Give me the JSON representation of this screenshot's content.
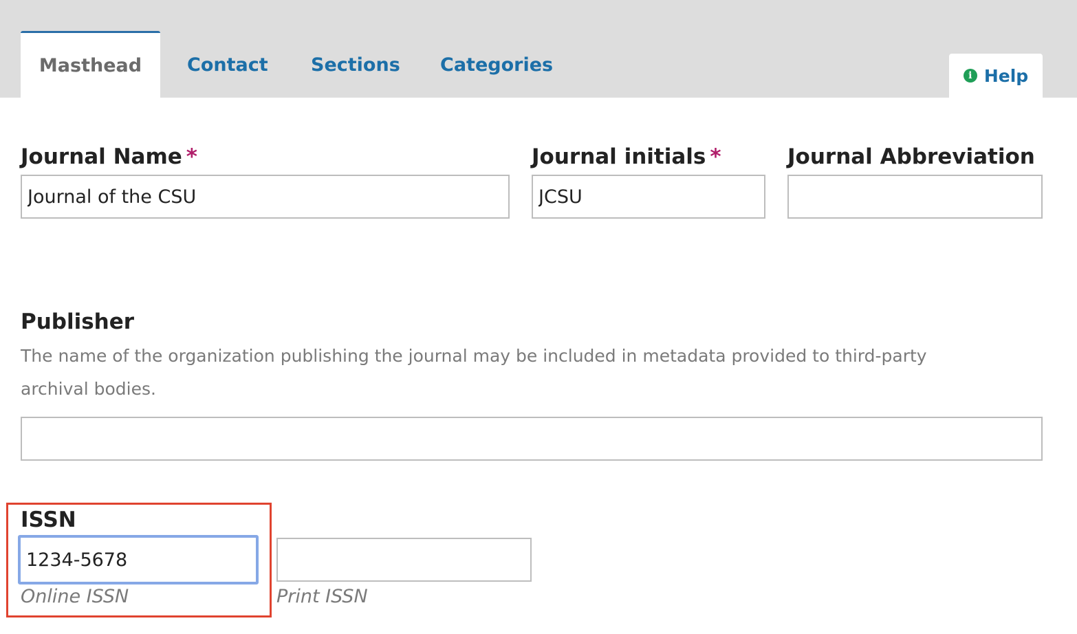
{
  "tabs": [
    {
      "label": "Masthead",
      "active": true
    },
    {
      "label": "Contact",
      "active": false
    },
    {
      "label": "Sections",
      "active": false
    },
    {
      "label": "Categories",
      "active": false
    }
  ],
  "help": {
    "label": "Help",
    "icon": "info-circle-icon"
  },
  "fields": {
    "journal_name": {
      "label": "Journal Name",
      "required": "*",
      "value": "Journal of the CSU"
    },
    "journal_initials": {
      "label": "Journal initials",
      "required": "*",
      "value": "JCSU"
    },
    "journal_abbreviation": {
      "label": "Journal Abbreviation",
      "value": ""
    },
    "publisher": {
      "label": "Publisher",
      "description": "The name of the organization publishing the journal may be included in metadata provided to third-party archival bodies.",
      "value": ""
    },
    "issn": {
      "label": "ISSN",
      "online": {
        "value": "1234-5678",
        "sublabel": "Online ISSN"
      },
      "print": {
        "value": "",
        "sublabel": "Print ISSN"
      }
    }
  },
  "colors": {
    "tab_link": "#1c6fa8",
    "required": "#b01e6a",
    "highlight": "#e0432f",
    "focus": "#86a8e6",
    "help_icon": "#1f9e57"
  }
}
